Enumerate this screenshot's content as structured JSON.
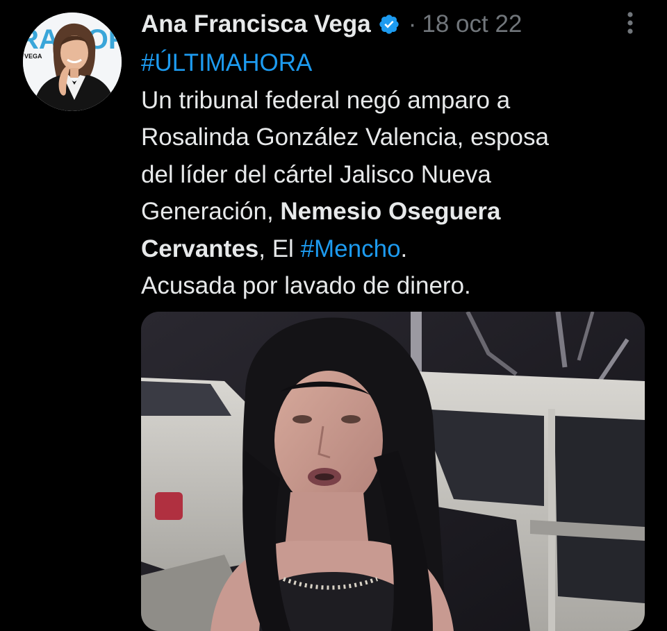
{
  "tweet": {
    "author_name": "Ana Francisca Vega",
    "separator": "·",
    "date": "18 oct 22",
    "hashtag_top": "#ÚLTIMAHORA",
    "lines": {
      "l1": "Un tribunal federal negó amparo a",
      "l2": "Rosalinda González Valencia, esposa",
      "l3": "del líder del cártel Jalisco Nueva",
      "l4_plain": "Generación, ",
      "l4_bold": "Nemesio Oseguera",
      "l5_bold": "Cervantes",
      "l5_mid": ", El ",
      "l5_hashtag": "#Mencho",
      "l5_end": ".",
      "l6": "Acusada por lavado de dinero."
    },
    "avatar_banner_text": "RADIOFÓRMULA",
    "avatar_banner_sub": "VEGA"
  },
  "icons": {
    "verified": "verified-badge-icon",
    "more": "more-options-icon"
  },
  "colors": {
    "background": "#000000",
    "text": "#e7e9ea",
    "muted": "#71767b",
    "link": "#1d9bf0"
  }
}
